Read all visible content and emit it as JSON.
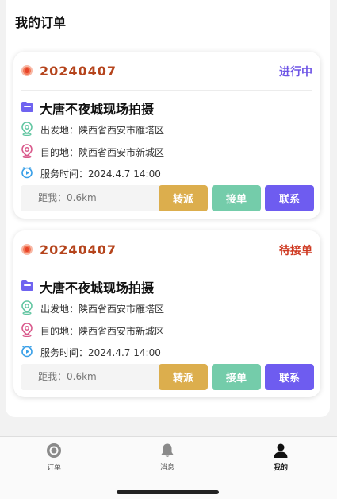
{
  "section_title": "我的订单",
  "orders": [
    {
      "order_no": "20240407",
      "status": "进行中",
      "title": "大唐不夜城现场拍摄",
      "departure": "出发地：陕西省西安市雁塔区",
      "destination": "目的地：陕西省西安市新城区",
      "service_time": "服务时间：2024.4.7 14:00",
      "distance": "距我：0.6km",
      "btn_transfer": "转派",
      "btn_accept": "接单",
      "btn_contact": "联系"
    },
    {
      "order_no": "20240407",
      "status": "待接单",
      "title": "大唐不夜城现场拍摄",
      "departure": "出发地：陕西省西安市雁塔区",
      "destination": "目的地：陕西省西安市新城区",
      "service_time": "服务时间：2024.4.7 14:00",
      "distance": "距我：0.6km",
      "btn_transfer": "转派",
      "btn_accept": "接单",
      "btn_contact": "联系"
    }
  ],
  "tabbar": {
    "orders_label": "订单",
    "messages_label": "消息",
    "mine_label": "我的",
    "active": "我的"
  },
  "colors": {
    "order_no": "#b5441c",
    "status_in_progress": "#6e55e6",
    "status_waiting": "#cf3a22",
    "btn_transfer": "#dcae4d",
    "btn_accept": "#74ccaa",
    "btn_contact": "#6e5cf0"
  },
  "icons": [
    "folder-icon",
    "departure-pin-icon",
    "destination-pin-icon",
    "clock-icon",
    "order-status-dot-icon",
    "orders-tab-icon",
    "bell-icon",
    "user-icon"
  ]
}
